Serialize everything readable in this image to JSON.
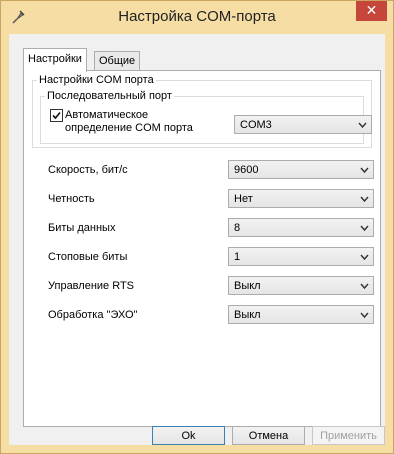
{
  "window": {
    "title": "Настройка COM-порта",
    "close_symbol": "✕"
  },
  "tabs": [
    {
      "label": "Настройки",
      "active": true
    },
    {
      "label": "Общие",
      "active": false
    }
  ],
  "group_com": {
    "legend": "Настройки COM порта"
  },
  "group_serial": {
    "legend": "Последовательный порт",
    "auto_detect": {
      "label": "Автоматическое определение COM порта",
      "checked": true
    },
    "port": {
      "value": "COM3"
    }
  },
  "settings": [
    {
      "label": "Скорость, бит/с",
      "value": "9600"
    },
    {
      "label": "Четность",
      "value": "Нет"
    },
    {
      "label": "Биты данных",
      "value": "8"
    },
    {
      "label": "Стоповые биты",
      "value": "1"
    },
    {
      "label": "Управление RTS",
      "value": "Выкл"
    },
    {
      "label": "Обработка \"ЭХО\"",
      "value": "Выкл"
    }
  ],
  "buttons": {
    "ok": "Ok",
    "cancel": "Отмена",
    "apply": "Применить"
  },
  "icons": {
    "app": "plug-icon",
    "close": "close-icon",
    "dropdown": "chevron-down-icon",
    "check": "checkmark-icon"
  },
  "colors": {
    "title_bg": "#f6dda4",
    "close_bg": "#c7463c",
    "default_border": "#3c7fb1"
  }
}
